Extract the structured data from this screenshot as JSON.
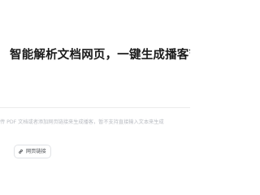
{
  "hero": {
    "title": "智能解析文档网页，一键生成播客节目"
  },
  "composer": {
    "prompt_text": "传 PDF 文档或者添加网页链接来生成播客，暂不支持直接输入文本来生成",
    "link_button_label": "网页链接",
    "link_icon": "link-icon"
  }
}
